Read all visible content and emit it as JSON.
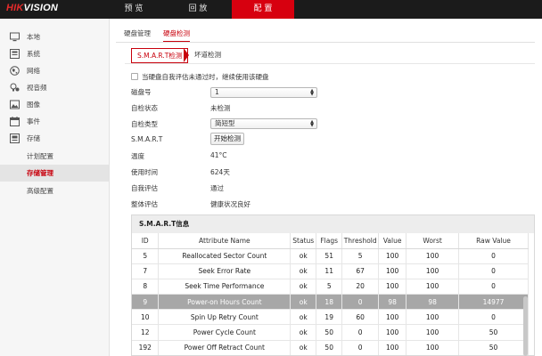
{
  "app": {
    "logo_prefix": "HIK",
    "logo_suffix": "VISION"
  },
  "topnav": {
    "items": [
      {
        "label": "预 览"
      },
      {
        "label": "回 放"
      },
      {
        "label": "配 置",
        "active": true
      }
    ]
  },
  "sidebar": {
    "items": [
      {
        "label": "本地",
        "icon": "monitor-icon"
      },
      {
        "label": "系统",
        "icon": "system-icon"
      },
      {
        "label": "网络",
        "icon": "globe-icon"
      },
      {
        "label": "视音频",
        "icon": "audio-video-icon"
      },
      {
        "label": "图像",
        "icon": "image-icon"
      },
      {
        "label": "事件",
        "icon": "event-icon"
      },
      {
        "label": "存储",
        "icon": "storage-icon"
      },
      {
        "label": "计划配置"
      },
      {
        "label": "存储管理",
        "active": true
      },
      {
        "label": "高级配置"
      }
    ]
  },
  "tabs": {
    "primary": [
      {
        "label": "硬盘管理"
      },
      {
        "label": "硬盘检测",
        "active": true
      }
    ],
    "secondary": [
      {
        "label": "S.M.A.R.T检测",
        "active": true
      },
      {
        "label": "坏道检测"
      }
    ]
  },
  "form": {
    "continue_checkbox_label": "当硬盘自我评估未通过时，继续使用该硬盘",
    "continue_checked": false,
    "disk_no_label": "磁盘号",
    "disk_no_value": "1",
    "self_test_status_label": "自检状态",
    "self_test_status_value": "未检测",
    "self_test_type_label": "自检类型",
    "self_test_type_value": "简短型",
    "smart_label": "S.M.A.R.T",
    "start_button": "开始检测",
    "temperature_label": "温度",
    "temperature_value": "41°C",
    "usage_time_label": "使用时间",
    "usage_time_value": "624天",
    "self_eval_label": "自我评估",
    "self_eval_value": "通过",
    "overall_eval_label": "整体评估",
    "overall_eval_value": "健康状况良好"
  },
  "smart_table": {
    "title": "S.M.A.R.T信息",
    "columns": [
      "ID",
      "Attribute Name",
      "Status",
      "Flags",
      "Threshold",
      "Value",
      "Worst",
      "Raw Value"
    ],
    "rows": [
      [
        "5",
        "Reallocated Sector Count",
        "ok",
        "51",
        "5",
        "100",
        "100",
        "0"
      ],
      [
        "7",
        "Seek Error Rate",
        "ok",
        "11",
        "67",
        "100",
        "100",
        "0"
      ],
      [
        "8",
        "Seek Time Performance",
        "ok",
        "5",
        "20",
        "100",
        "100",
        "0"
      ],
      [
        "9",
        "Power-on Hours Count",
        "ok",
        "18",
        "0",
        "98",
        "98",
        "14977"
      ],
      [
        "10",
        "Spin Up Retry Count",
        "ok",
        "19",
        "60",
        "100",
        "100",
        "0"
      ],
      [
        "12",
        "Power Cycle Count",
        "ok",
        "50",
        "0",
        "100",
        "100",
        "50"
      ],
      [
        "192",
        "Power Off Retract Count",
        "ok",
        "50",
        "0",
        "100",
        "100",
        "50"
      ],
      [
        "",
        "",
        "",
        "",
        "",
        "",
        "",
        ""
      ]
    ],
    "selected_row_index": 3
  },
  "colors": {
    "accent": "#d7000f",
    "topbar": "#1b1b1b",
    "selected_row": "#a7a7a7"
  }
}
